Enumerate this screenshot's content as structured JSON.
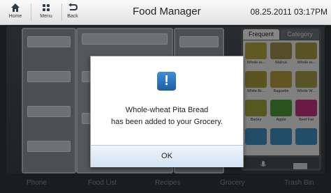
{
  "header": {
    "home_label": "Home",
    "menu_label": "Menu",
    "back_label": "Back",
    "title": "Food Manager",
    "datetime": "08.25.2011 03:17PM"
  },
  "side_panel": {
    "tabs": [
      "Frequent",
      "Category"
    ],
    "items": [
      {
        "name": "Whole-w...",
        "color": "#b0a33c"
      },
      {
        "name": "Walnut",
        "color": "#9b8a4e"
      },
      {
        "name": "Whole-w...",
        "color": "#a3963f"
      },
      {
        "name": "White Br...",
        "color": "#a6973a"
      },
      {
        "name": "Baguette",
        "color": "#b59b3f"
      },
      {
        "name": "Whole W...",
        "color": "#a39a45"
      },
      {
        "name": "Barley",
        "color": "#9fa03a"
      },
      {
        "name": "Apple",
        "color": "#4c9a3a"
      },
      {
        "name": "Beef Fat",
        "color": "#c0327a"
      },
      {
        "name": "",
        "color": "#3f8dbd"
      },
      {
        "name": "",
        "color": "#3f8dbd"
      },
      {
        "name": "",
        "color": "#3f8dbd"
      }
    ]
  },
  "bottom_nav": [
    "Phone",
    "Food List",
    "Recipes",
    "Grocery",
    "Trash Bin"
  ],
  "dialog": {
    "icon": "!",
    "line1": "Whole-wheat Pita Bread",
    "line2": "has been added to your Grocery.",
    "ok_label": "OK"
  }
}
